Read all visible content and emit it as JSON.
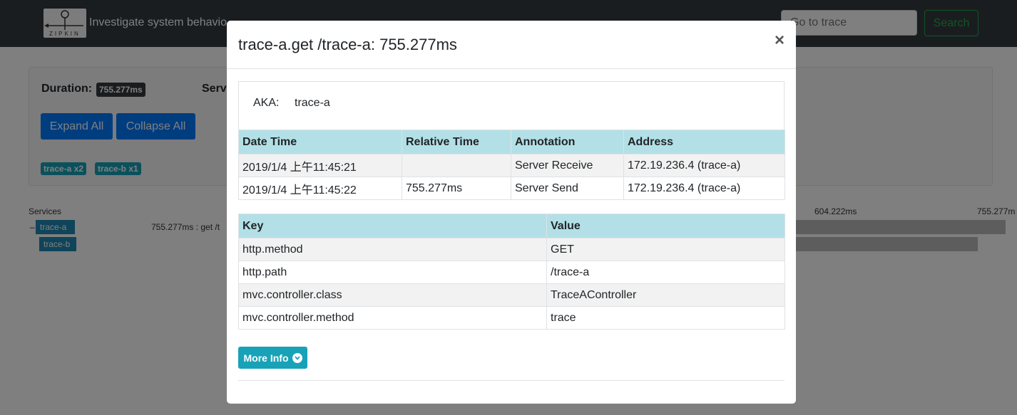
{
  "navbar": {
    "logo_text": "ZIPKIN",
    "tagline": "Investigate system behavio",
    "search_placeholder": "Go to trace",
    "search_button": "Search"
  },
  "summary": {
    "duration_label": "Duration:",
    "duration_value": "755.277ms",
    "services_label": "Serv",
    "expand_all": "Expand All",
    "collapse_all": "Collapse All",
    "service_pills": [
      "trace-a x2",
      "trace-b x1"
    ]
  },
  "timeline": {
    "services_header": "Services",
    "minus": "–",
    "services": [
      "trace-a",
      "trace-b"
    ],
    "ticks": [
      "604.222ms",
      "755.277m"
    ],
    "span_label": "755.277ms : get /t"
  },
  "modal": {
    "title": "trace-a.get /trace-a: 755.277ms",
    "close_symbol": "×",
    "aka_label": "AKA:",
    "aka_value": "trace-a",
    "annotations": {
      "headers": [
        "Date Time",
        "Relative Time",
        "Annotation",
        "Address"
      ],
      "rows": [
        [
          "2019/1/4 上午11:45:21",
          "",
          "Server Receive",
          "172.19.236.4 (trace-a)"
        ],
        [
          "2019/1/4 上午11:45:22",
          "755.277ms",
          "Server Send",
          "172.19.236.4 (trace-a)"
        ]
      ]
    },
    "tags": {
      "headers": [
        "Key",
        "Value"
      ],
      "rows": [
        [
          "http.method",
          "GET"
        ],
        [
          "http.path",
          "/trace-a"
        ],
        [
          "mvc.controller.class",
          "TraceAController"
        ],
        [
          "mvc.controller.method",
          "trace"
        ]
      ]
    },
    "more_info": "More Info",
    "more_info_icon": "chevron-circle-down-icon"
  },
  "colors": {
    "navbar": "#343a40",
    "primary": "#007bff",
    "info": "#17a2b8",
    "table_header": "#b3e0e6"
  }
}
